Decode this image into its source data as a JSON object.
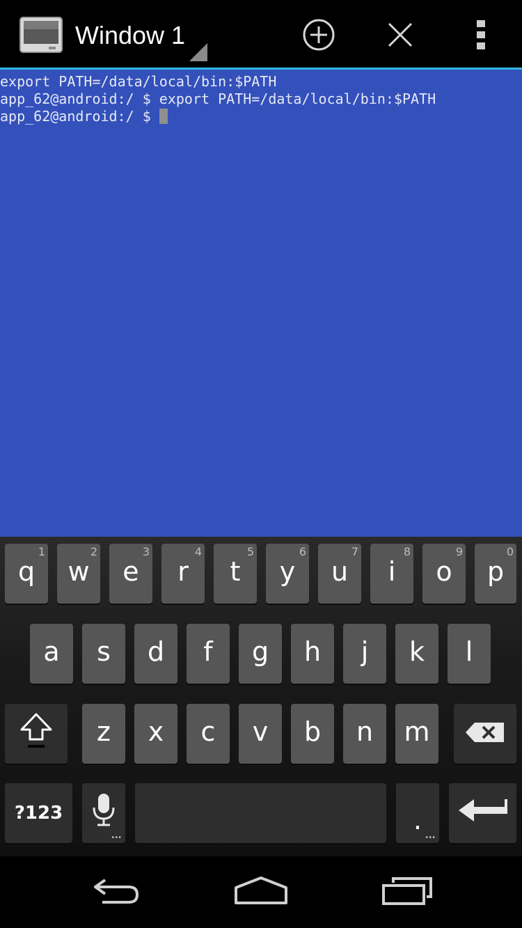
{
  "actionbar": {
    "window_title": "Window 1",
    "new_window_icon": "plus-circle-icon",
    "close_window_icon": "close-icon",
    "overflow_icon": "overflow-menu-icon",
    "accent_color": "#33b5e5"
  },
  "terminal": {
    "background": "#3350bb",
    "lines": [
      "export PATH=/data/local/bin:$PATH",
      "app_62@android:/ $ export PATH=/data/local/bin:$PATH",
      "app_62@android:/ $ "
    ]
  },
  "keyboard": {
    "row1": [
      {
        "label": "q",
        "hint": "1"
      },
      {
        "label": "w",
        "hint": "2"
      },
      {
        "label": "e",
        "hint": "3"
      },
      {
        "label": "r",
        "hint": "4"
      },
      {
        "label": "t",
        "hint": "5"
      },
      {
        "label": "y",
        "hint": "6"
      },
      {
        "label": "u",
        "hint": "7"
      },
      {
        "label": "i",
        "hint": "8"
      },
      {
        "label": "o",
        "hint": "9"
      },
      {
        "label": "p",
        "hint": "0"
      }
    ],
    "row2": [
      "a",
      "s",
      "d",
      "f",
      "g",
      "h",
      "j",
      "k",
      "l"
    ],
    "row3": [
      "z",
      "x",
      "c",
      "v",
      "b",
      "n",
      "m"
    ],
    "symbols_label": "?123",
    "period_label": ".",
    "shift_icon": "shift-icon",
    "backspace_icon": "backspace-icon",
    "mic_icon": "microphone-icon",
    "enter_icon": "enter-icon"
  },
  "navbar": {
    "back_icon": "back-icon",
    "home_icon": "home-icon",
    "recents_icon": "recent-apps-icon"
  }
}
